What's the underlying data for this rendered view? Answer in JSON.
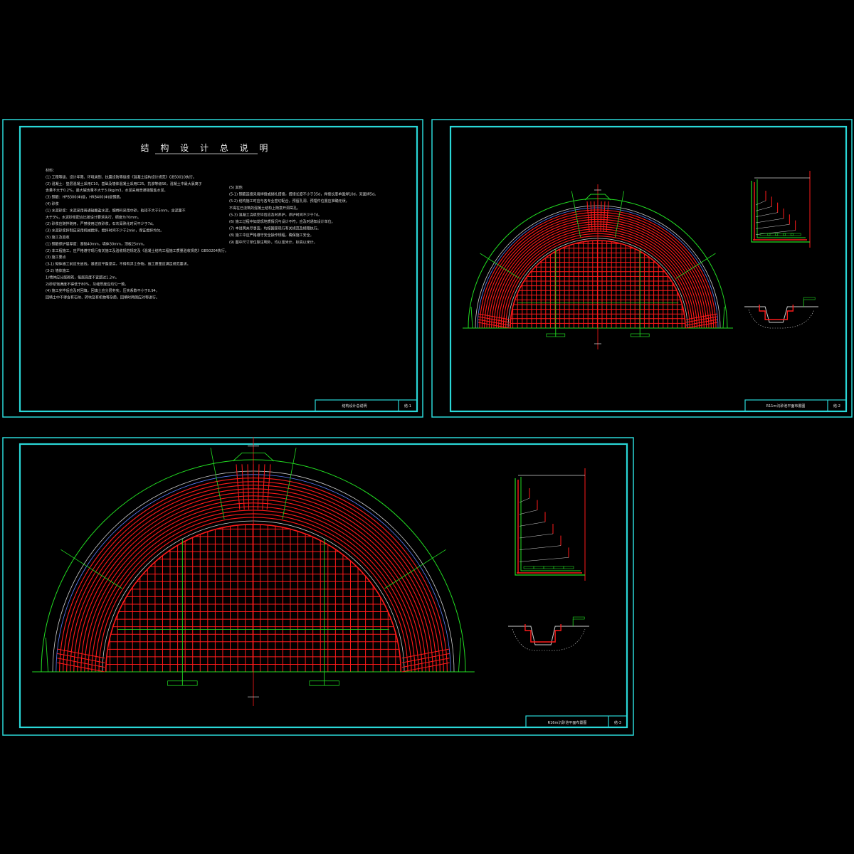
{
  "sheets": {
    "s1": {
      "heading": "结 构 设 计 总 说 明",
      "titleblock_name": "结构设计总说明",
      "titleblock_no": "结-1",
      "notes_left": [
        "材料：",
        "(1)   工程等级、设计年限、环境类别、抗震设防等级按《混凝土结构设计规范》GB50010执行。",
        "(2)   混凝土：垫层混凝土采用C10，基础及墙体混凝土采用C25，抗渗等级S6，混凝土中最大氯离子",
        "      含量不大于0.2%，最大碱含量不大于3.0kg/m3，水泥采用普通硅酸盐水泥。",
        "(3)   钢筋：HPB300(Φ)级，HRB400(Φ)级钢筋。",
        "(4)   砂浆",
        "   (1)   水泥砂浆：水泥采用普通硅酸盐水泥，细骨料采用中砂，粒径不大于5mm，含泥量不",
        "         大于3%，水泥砂浆配合比按设计要求执行，稠度为70mm。",
        "   (2)   砂浆应随拌随用，严禁使用过夜砂浆，石灰膏熟化时间不少于7d。",
        "   (3)   水泥砂浆拌制应采用机械搅拌，搅拌时间不少于2min，保证搅拌均匀。",
        "(5)   施工及验收",
        "   (1)   钢筋保护层厚度：基础40mm，墙体30mm，顶板25mm。",
        "   (2)   本工程施工，应严格遵守现行有关施工及验收规范规定及《混凝土结构工程施工质量验收规范》GB50204执行。",
        "   (3)   施工要点",
        "      (3-1) 砌体施工前应先放线，基底应平整坚实，不得有浮土杂物，施工质量应满足规范要求。",
        "      (3-2) 墙体施工",
        "            1)墙体应分层砌筑，每层高度不宜超过1.2m。",
        "            2)砂浆饱满度不得低于80%，灰缝厚度应均匀一致。",
        "   (4)   施工完毕后应及时回填，回填土应分层夯实，压实系数不小于0.94，",
        "         回填土中不得含有石块、砖块及有机物等杂质，回填时两侧应对称进行。"
      ],
      "notes_right": [
        "(5)   其他",
        "   (5-1) 钢筋连接采用焊接或绑扎搭接，搭接长度不小于35d，焊接长度单面焊10d，双面焊5d。",
        "   (5-2) 结构施工时应与各专业密切配合，预留孔洞、预埋件位置应准确无误，",
        "         不得在已浇筑的混凝土结构上随意开洞凿孔。",
        "   (5-3) 混凝土浇筑完毕后应及时养护，养护时间不少于7d。",
        "(6)   施工过程中如发现地质情况与设计不符，应及时通知设计单位。",
        "(7)   本说明未尽事宜，均按国家现行有关规范及规程执行。",
        "(8)   施工中应严格遵守安全操作规程，确保施工安全。",
        "(9)   图中尺寸单位除注明外，均以毫米计，标高以米计。"
      ]
    },
    "s2": {
      "titleblock_name": "R11m沉砂池平面布置图",
      "titleblock_no": "结-2"
    },
    "s3": {
      "titleblock_name": "R16m沉砂池平面布置图",
      "titleblock_no": "结-3"
    }
  },
  "colors": {
    "frame": "#2ad7d7",
    "rebar": "#ff1a1a",
    "outline": "#22dd22",
    "text": "#e8e8e8",
    "background": "#000000"
  }
}
